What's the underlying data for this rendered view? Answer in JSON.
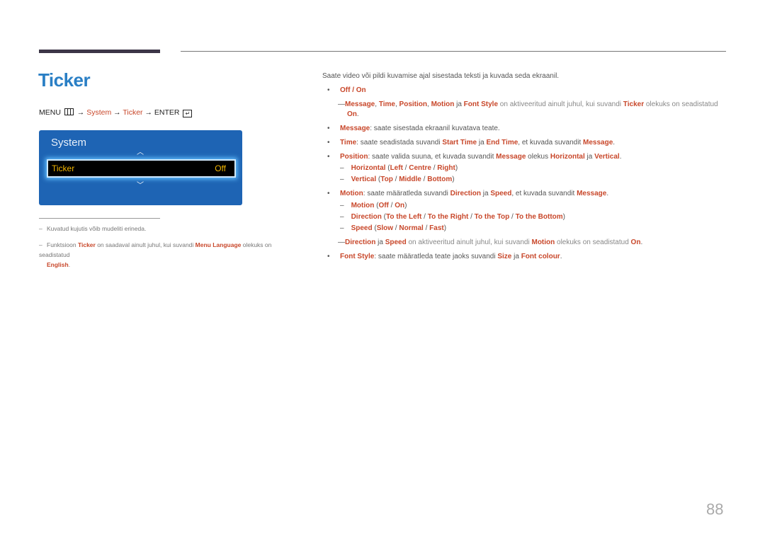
{
  "title": "Ticker",
  "menu_path": {
    "menu": "MENU",
    "arrow": "→",
    "system": "System",
    "ticker": "Ticker",
    "enter": "ENTER"
  },
  "osd": {
    "title": "System",
    "row_label": "Ticker",
    "row_value": "Off"
  },
  "notes": {
    "n1": "Kuvatud kujutis võib mudeliti erineda.",
    "n2_a": "Funktsioon ",
    "n2_ticker": "Ticker",
    "n2_b": " on saadaval ainult juhul, kui suvandi ",
    "n2_ml": "Menu Language",
    "n2_c": " olekuks on seadistatud ",
    "n2_en": "English",
    "n2_d": "."
  },
  "intro": "Saate video või pildi kuvamise ajal sisestada teksti ja kuvada seda ekraanil.",
  "items": {
    "offon": "Off / On",
    "note1": {
      "message": "Message",
      "time": "Time",
      "position": "Position",
      "motion": "Motion",
      "fontstyle": "Font Style",
      "ja": " ja ",
      "text": " on aktiveeritud ainult juhul, kui suvandi ",
      "ticker": "Ticker",
      "text2": " olekuks on seadistatud",
      "on": "On"
    },
    "message": {
      "label": "Message",
      "text": ": saate sisestada ekraanil kuvatava teate."
    },
    "time": {
      "label": "Time",
      "t1": ": saate seadistada suvandi ",
      "start": "Start Time",
      "ja": " ja ",
      "end": "End Time",
      "t2": ", et kuvada suvandit ",
      "msg": "Message"
    },
    "position": {
      "label": "Position",
      "t1": ": saate valida suuna, et kuvada suvandit ",
      "msg": "Message",
      "t2": " olekus ",
      "h": "Horizontal",
      "ja": " ja ",
      "v": "Vertical"
    },
    "horizontal": {
      "label": "Horizontal",
      "o1": "Left",
      "o2": "Centre",
      "o3": "Right"
    },
    "vertical": {
      "label": "Vertical",
      "o1": "Top",
      "o2": "Middle",
      "o3": "Bottom"
    },
    "motion": {
      "label": "Motion",
      "t1": ": saate määratleda suvandi ",
      "dir": "Direction",
      "ja": " ja ",
      "speed": "Speed",
      "t2": ", et kuvada suvandit ",
      "msg": "Message"
    },
    "motion_sub": {
      "label": "Motion",
      "o1": "Off",
      "o2": "On"
    },
    "direction": {
      "label": "Direction",
      "o1": "To the Left",
      "o2": "To the Right",
      "o3": "To the Top",
      "o4": "To the Bottom"
    },
    "speed": {
      "label": "Speed",
      "o1": "Slow",
      "o2": "Normal",
      "o3": "Fast"
    },
    "note2": {
      "dir": "Direction",
      "ja": " ja ",
      "speed": "Speed",
      "t1": " on aktiveeritud ainult juhul, kui suvandi ",
      "motion": "Motion",
      "t2": " olekuks on seadistatud ",
      "on": "On"
    },
    "fontstyle": {
      "label": "Font Style",
      "t1": ": saate määratleda teate jaoks suvandi ",
      "size": "Size",
      "ja": " ja ",
      "colour": "Font colour"
    }
  },
  "page_number": "88"
}
